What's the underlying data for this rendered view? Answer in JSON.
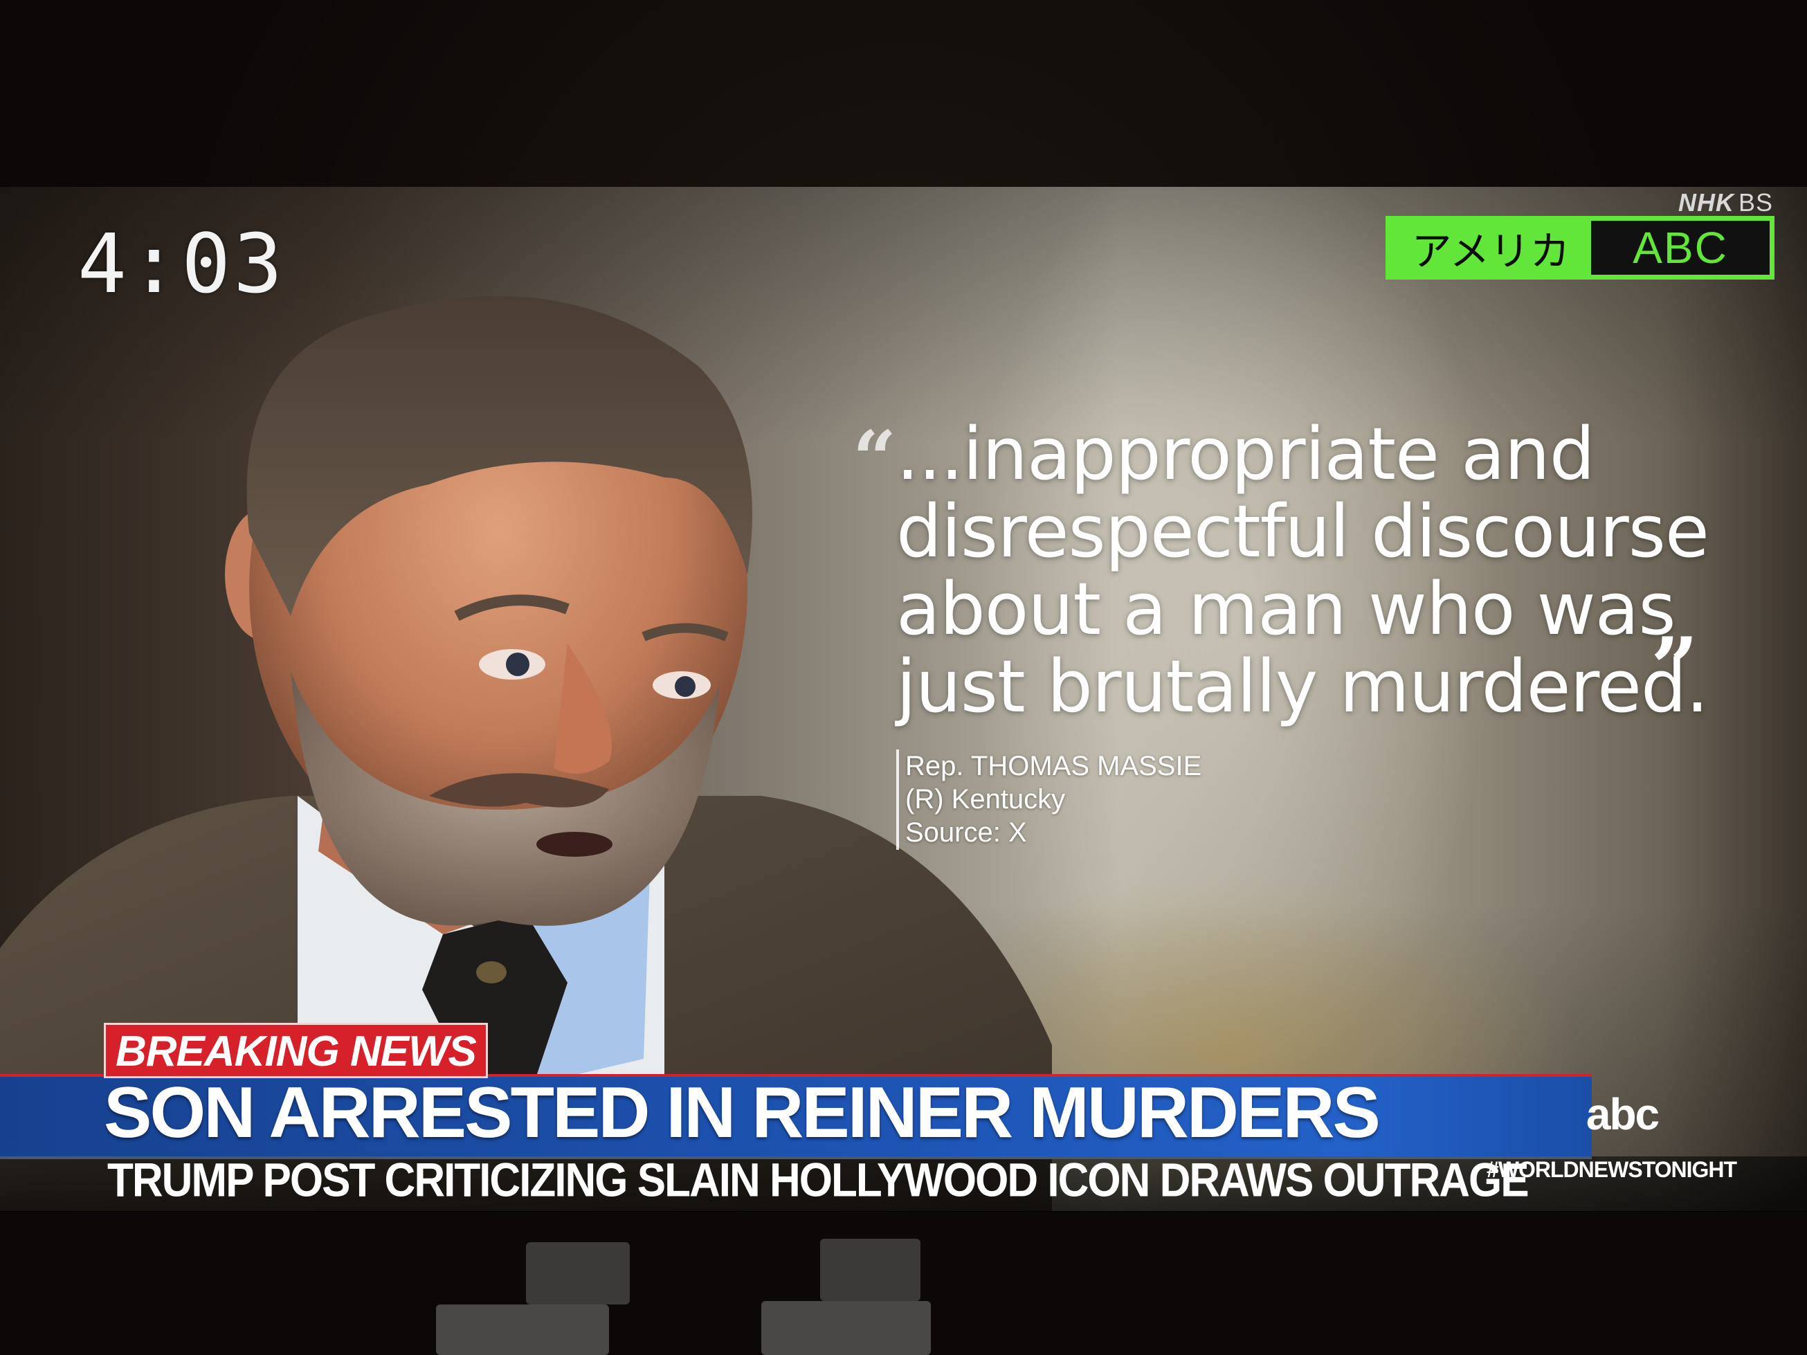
{
  "clock": "4:03",
  "broadcaster": {
    "nhk": "NHK",
    "bs": "BS"
  },
  "source_box": {
    "country": "アメリカ",
    "network": "ABC"
  },
  "quote": {
    "lines": [
      "...inappropriate and",
      "disrespectful discourse",
      "about a man who was",
      "just brutally murdered."
    ],
    "open_mark": "“",
    "close_mark": "”"
  },
  "attribution": {
    "name": "Rep. THOMAS MASSIE",
    "party_state": "(R) Kentucky",
    "source": "Source: X"
  },
  "lower_third": {
    "breaking": "BREAKING NEWS",
    "headline": "SON ARRESTED IN REINER MURDERS",
    "subheadline": "TRUMP POST CRITICIZING SLAIN HOLLYWOOD ICON DRAWS OUTRAGE",
    "logo": "abc",
    "hashtag": "#WORLDNEWSTONIGHT"
  },
  "colors": {
    "source_green": "#63e63a",
    "breaking_red": "#d6212b",
    "headline_blue": "#1d52b0"
  }
}
